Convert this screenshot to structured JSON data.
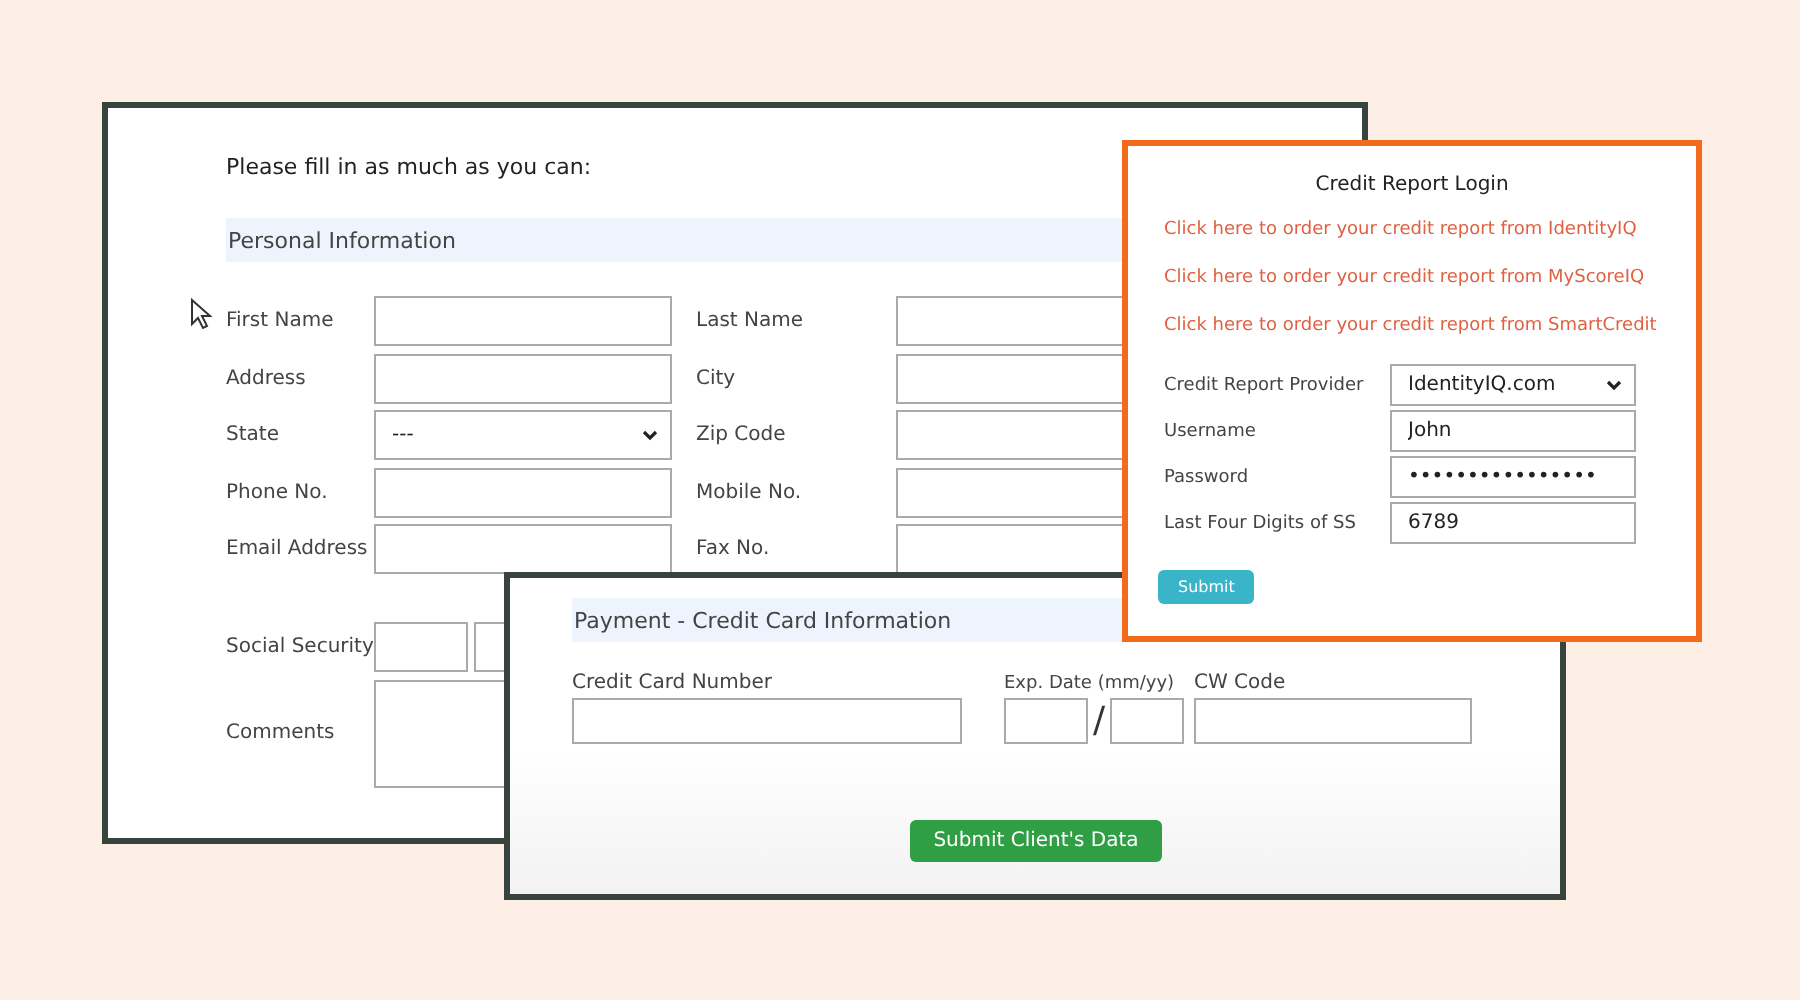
{
  "main_form": {
    "intro": "Please fill in as much as you can:",
    "heading": "Personal Information",
    "rows": [
      {
        "left": {
          "label": "First Name",
          "kind": "text"
        },
        "right": {
          "label": "Last Name",
          "kind": "text"
        }
      },
      {
        "left": {
          "label": "Address",
          "kind": "text"
        },
        "right": {
          "label": "City",
          "kind": "text"
        }
      },
      {
        "left": {
          "label": "State",
          "kind": "select",
          "value": "---"
        },
        "right": {
          "label": "Zip Code",
          "kind": "text"
        }
      },
      {
        "left": {
          "label": "Phone No.",
          "kind": "text"
        },
        "right": {
          "label": "Mobile No.",
          "kind": "text"
        }
      },
      {
        "left": {
          "label": "Email Address",
          "kind": "text"
        },
        "right": {
          "label": "Fax No.",
          "kind": "text"
        }
      }
    ],
    "social_security": {
      "label": "Social Security"
    },
    "comments": {
      "label": "Comments"
    }
  },
  "payment": {
    "heading": "Payment - Credit Card Information",
    "card_label": "Credit Card Number",
    "exp_label": "Exp. Date (mm/yy)",
    "separator": "/",
    "cvv_label": "CW Code",
    "submit": "Submit Client's Data"
  },
  "login": {
    "title": "Credit Report Login",
    "links": [
      "Click here to order your credit report from IdentityIQ",
      "Click here to order your credit report from MyScoreIQ",
      "Click here to order your credit report from SmartCredit"
    ],
    "fields": [
      {
        "label": "Credit Report Provider",
        "kind": "select",
        "value": "IdentityIQ.com"
      },
      {
        "label": "Username",
        "kind": "text",
        "value": "John"
      },
      {
        "label": "Password",
        "kind": "text",
        "value": "••••••••••••••••"
      },
      {
        "label": "Last Four Digits of SS",
        "kind": "text",
        "value": "6789"
      }
    ],
    "submit": "Submit"
  }
}
